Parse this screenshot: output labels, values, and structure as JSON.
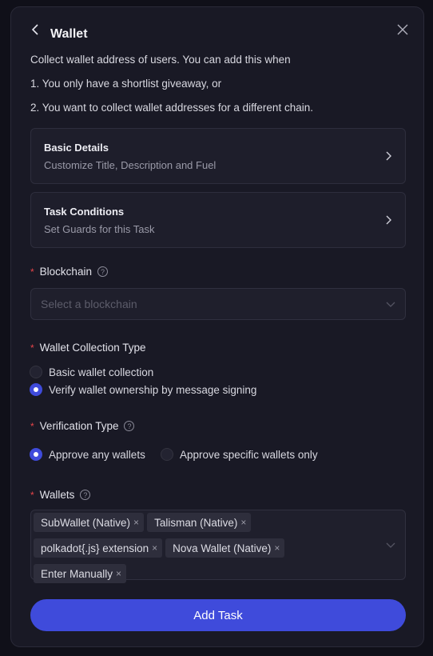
{
  "modal": {
    "title": "Wallet",
    "description": [
      "Collect wallet address of users. You can add this when",
      "1. You only have a shortlist giveaway, or",
      "2. You want to collect wallet addresses for a different chain."
    ],
    "cards": [
      {
        "title": "Basic Details",
        "subtitle": "Customize Title, Description and Fuel"
      },
      {
        "title": "Task Conditions",
        "subtitle": "Set Guards for this Task"
      }
    ],
    "blockchain": {
      "label": "Blockchain",
      "placeholder": "Select a blockchain"
    },
    "collection_type": {
      "label": "Wallet Collection Type",
      "options": [
        "Basic wallet collection",
        "Verify wallet ownership by message signing"
      ],
      "selected": 1
    },
    "verification_type": {
      "label": "Verification Type",
      "options": [
        "Approve any wallets",
        "Approve specific wallets only"
      ],
      "selected": 0
    },
    "wallets": {
      "label": "Wallets",
      "tags": [
        "SubWallet (Native)",
        "Talisman (Native)",
        "polkadot{.js} extension",
        "Nova Wallet (Native)",
        "Enter Manually"
      ]
    },
    "submit_label": "Add Task",
    "required_mark": "*",
    "help_mark": "?",
    "remove_mark": "×"
  },
  "colors": {
    "accent": "#3f4bdb",
    "required": "#e8454a",
    "background": "#191925"
  }
}
